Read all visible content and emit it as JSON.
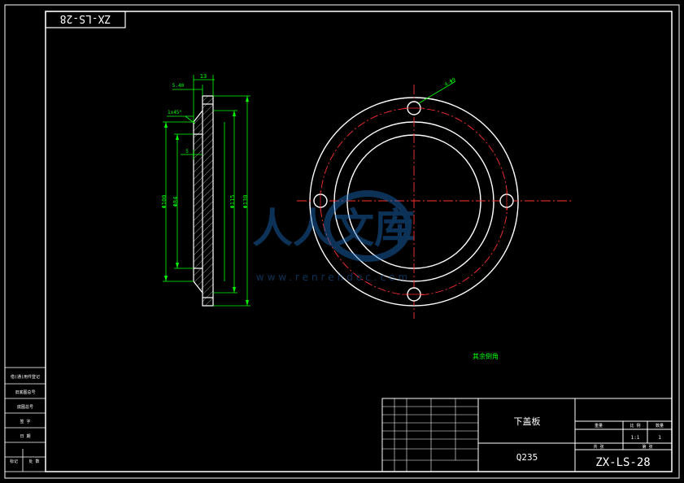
{
  "drawing": {
    "code_top": "ZX-LS-28",
    "code_bottom": "ZX-LS-28",
    "part_name": "下盖板",
    "material": "Q235",
    "tech_note": "其余倒角",
    "watermark_text": "人人文库",
    "watermark_url": "www.renrendoc.com"
  },
  "dimensions": {
    "d_outer": "Φ130",
    "d_bolt": "Φ115",
    "d_inner": "Φ100",
    "d_bore": "Φ84",
    "thickness": "13",
    "step": "5.40",
    "step2": "5",
    "chamfer": "1x45°",
    "holes": "4-Φ9"
  },
  "title_block": {
    "ratio_label": "比 例",
    "ratio_value": "1:1",
    "qty_label": "数量",
    "qty_value": "1",
    "weight_label": "重量",
    "sheet_label": "共 张",
    "sheet_no_label": "第 张"
  },
  "side_block": {
    "r1": "借(通)用件登记",
    "r2": "旧底图总号",
    "r3": "底图总号",
    "r4": "签 字",
    "r5": "日 期",
    "r6": "标记",
    "r7": "处 数"
  },
  "colors": {
    "line": "#ffffff",
    "dim": "#00ff00",
    "center": "#ff0000"
  }
}
